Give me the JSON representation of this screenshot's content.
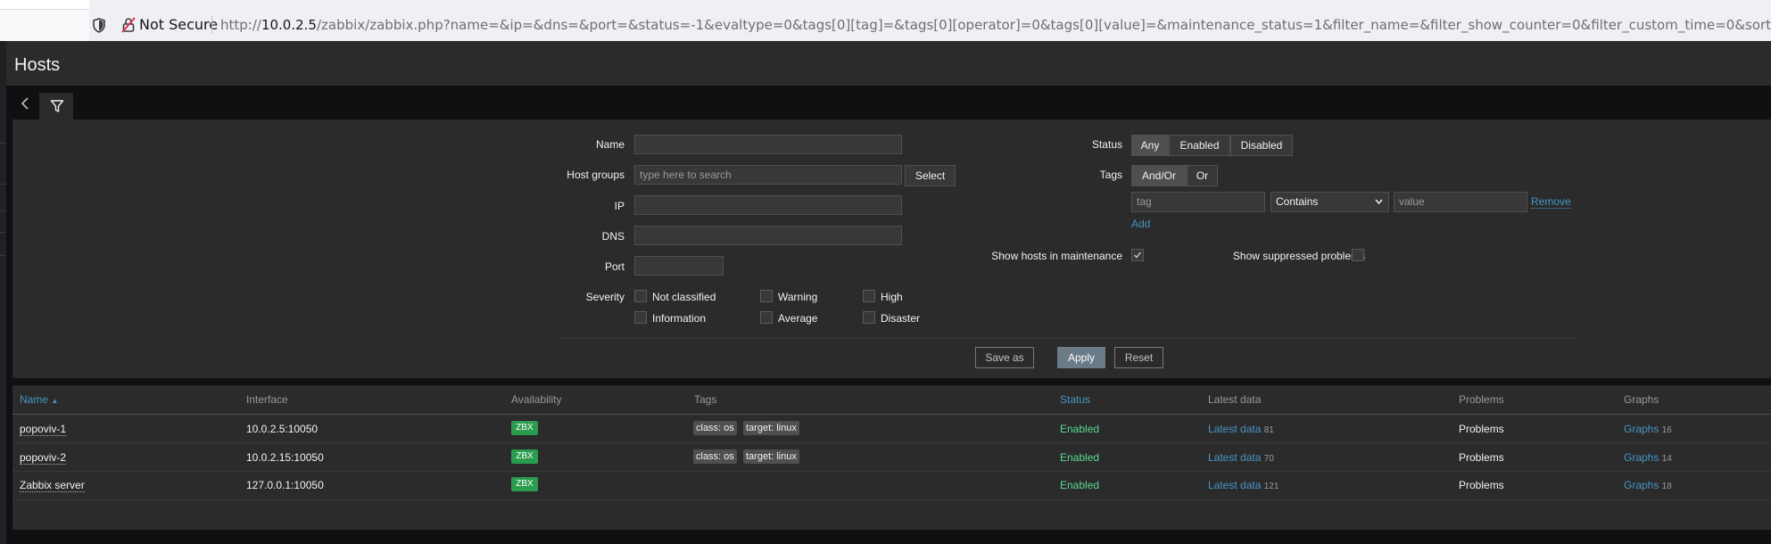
{
  "browser": {
    "security_label": "Not Secure",
    "url_prefix": "http://",
    "url_host": "10.0.2.5",
    "url_rest": "/zabbix/zabbix.php?name=&ip=&dns=&port=&status=-1&evaltype=0&tags[0][tag]=&tags[0][operator]=0&tags[0][value]=&maintenance_status=1&filter_name=&filter_show_counter=0&filter_custom_time=0&sort=name&sortorder=ASC&sh"
  },
  "page": {
    "title": "Hosts"
  },
  "filter": {
    "name_label": "Name",
    "name_value": "",
    "host_groups_label": "Host groups",
    "host_groups_placeholder": "type here to search",
    "select_label": "Select",
    "ip_label": "IP",
    "dns_label": "DNS",
    "port_label": "Port",
    "severity_label": "Severity",
    "severities": [
      "Not classified",
      "Warning",
      "High",
      "Information",
      "Average",
      "Disaster"
    ],
    "status_label": "Status",
    "status_options": [
      "Any",
      "Enabled",
      "Disabled"
    ],
    "status_selected": "Any",
    "tags_label": "Tags",
    "tag_eval_options": [
      "And/Or",
      "Or"
    ],
    "tag_eval_selected": "And/Or",
    "tag_placeholder": "tag",
    "tag_operator": "Contains",
    "tag_value_placeholder": "value",
    "remove_label": "Remove",
    "add_label": "Add",
    "show_maintenance_label": "Show hosts in maintenance",
    "show_maintenance_checked": true,
    "show_suppressed_label": "Show suppressed problems",
    "show_suppressed_checked": false,
    "save_as_label": "Save as",
    "apply_label": "Apply",
    "reset_label": "Reset"
  },
  "table": {
    "columns": [
      "Name",
      "Interface",
      "Availability",
      "Tags",
      "Status",
      "Latest data",
      "Problems",
      "Graphs"
    ],
    "sort_indicator": "▲",
    "rows": [
      {
        "name": "popoviv-1",
        "interface": "10.0.2.5:10050",
        "availability": "ZBX",
        "tags": [
          "class: os",
          "target: linux"
        ],
        "status": "Enabled",
        "latest_label": "Latest data",
        "latest_count": "81",
        "problems": "Problems",
        "graphs_label": "Graphs",
        "graphs_count": "16"
      },
      {
        "name": "popoviv-2",
        "interface": "10.0.2.15:10050",
        "availability": "ZBX",
        "tags": [
          "class: os",
          "target: linux"
        ],
        "status": "Enabled",
        "latest_label": "Latest data",
        "latest_count": "70",
        "problems": "Problems",
        "graphs_label": "Graphs",
        "graphs_count": "14"
      },
      {
        "name": "Zabbix server",
        "interface": "127.0.0.1:10050",
        "availability": "ZBX",
        "tags": [],
        "status": "Enabled",
        "latest_label": "Latest data",
        "latest_count": "121",
        "problems": "Problems",
        "graphs_label": "Graphs",
        "graphs_count": "18"
      }
    ]
  },
  "colors": {
    "accent_link": "#4796c4",
    "enabled_green": "#59db8f",
    "zbx_badge": "#2a9c4e",
    "panel_bg": "#2b2b2b",
    "page_bg": "#0e1012"
  },
  "icons": [
    "shield-icon",
    "not-secure-lock-icon",
    "collapse-chevron-icon",
    "filter-funnel-icon",
    "dropdown-chevron-icon",
    "checkmark-icon"
  ]
}
